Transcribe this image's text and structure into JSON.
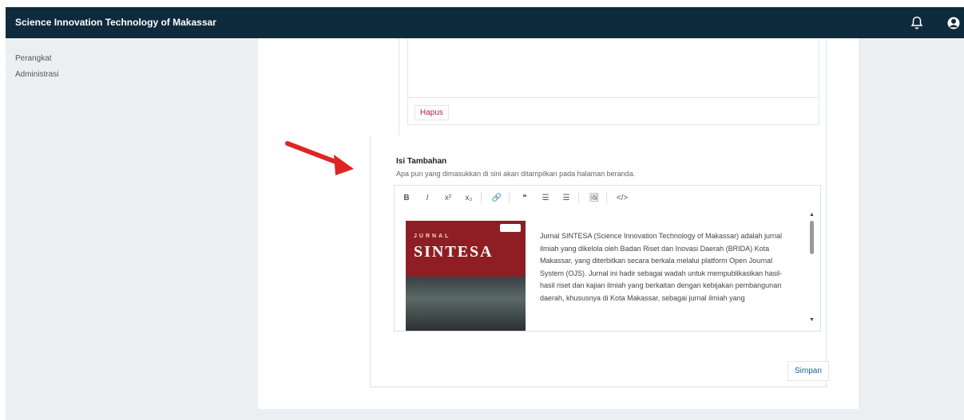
{
  "header": {
    "title": "Science Innovation Technology of Makassar",
    "icons": [
      "bell-icon",
      "user-circle-icon"
    ]
  },
  "sidebar": {
    "items": [
      {
        "label": "Perangkat"
      },
      {
        "label": "Administrasi"
      }
    ]
  },
  "form": {
    "hapus_label": "Hapus",
    "section_label": "Isi Tambahan",
    "section_desc": "Apa pun yang dimasukkan di sini akan ditampilkan pada halaman beranda.",
    "toolbar": [
      "B",
      "I",
      "x²",
      "x₂",
      "🔗",
      "❝",
      "☰",
      "☰",
      "🖼",
      "</>"
    ],
    "cover": {
      "top": "JURNAL",
      "title": "SINTESA"
    },
    "content": "Jurnal SINTESA (Science Innovation Technology of Makassar) adalah jurnal ilmiah yang dikelola oleh Badan Riset dan Inovasi Daerah (BRIDA) Kota Makassar, yang diterbitkan secara berkala melalui platform Open Journal System (OJS). Jurnal ini hadir sebagai wadah untuk mempublikasikan hasil-hasil riset dan kajian ilmiah yang berkaitan dengan kebijakan pembangunan daerah, khususnya di Kota Makassar, sebagai jurnal ilmiah yang",
    "save_label": "Simpan"
  },
  "colors": {
    "header_bg": "#0f2a3d",
    "cover_red": "#8f1e24",
    "annotation_arrow": "#e02424"
  }
}
